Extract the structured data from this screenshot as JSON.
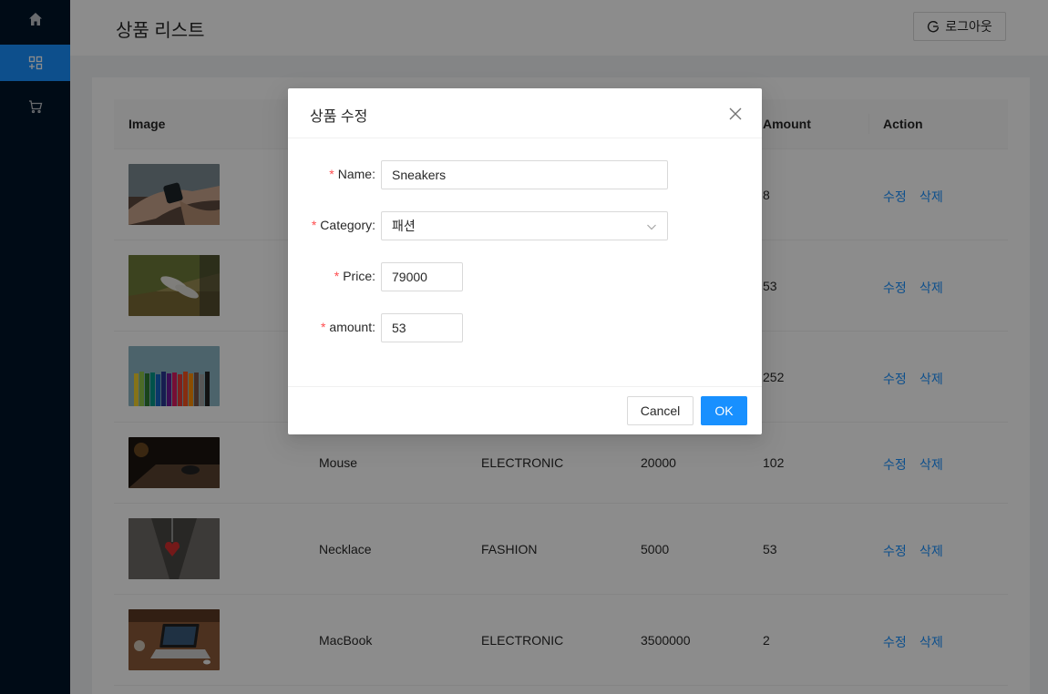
{
  "page": {
    "title": "상품 리스트",
    "logout_label": "로그아웃"
  },
  "sidebar": {
    "items": [
      {
        "icon": "home-icon"
      },
      {
        "icon": "appstore-add-icon",
        "active": true
      },
      {
        "icon": "shopping-cart-icon"
      }
    ]
  },
  "table": {
    "headers": {
      "image": "Image",
      "amount": "Amount",
      "action": "Action"
    },
    "edit_label": "수정",
    "delete_label": "삭제",
    "rows": [
      {
        "name": "",
        "category": "",
        "price": "",
        "amount": "8"
      },
      {
        "name": "",
        "category": "",
        "price": "",
        "amount": "53"
      },
      {
        "name": "",
        "category": "",
        "price": "",
        "amount": "252"
      },
      {
        "name": "Mouse",
        "category": "ELECTRONIC",
        "price": "20000",
        "amount": "102"
      },
      {
        "name": "Necklace",
        "category": "FASHION",
        "price": "5000",
        "amount": "53"
      },
      {
        "name": "MacBook",
        "category": "ELECTRONIC",
        "price": "3500000",
        "amount": "2"
      }
    ]
  },
  "modal": {
    "title": "상품 수정",
    "fields": {
      "name": {
        "label": "Name",
        "value": "Sneakers"
      },
      "category": {
        "label": "Category",
        "value": "패션"
      },
      "price": {
        "label": "Price",
        "value": "79000"
      },
      "amount": {
        "label": "amount",
        "value": "53"
      }
    },
    "cancel_label": "Cancel",
    "ok_label": "OK"
  },
  "colors": {
    "primary": "#1890ff",
    "sider": "#001529",
    "required": "#ff4d4f"
  }
}
